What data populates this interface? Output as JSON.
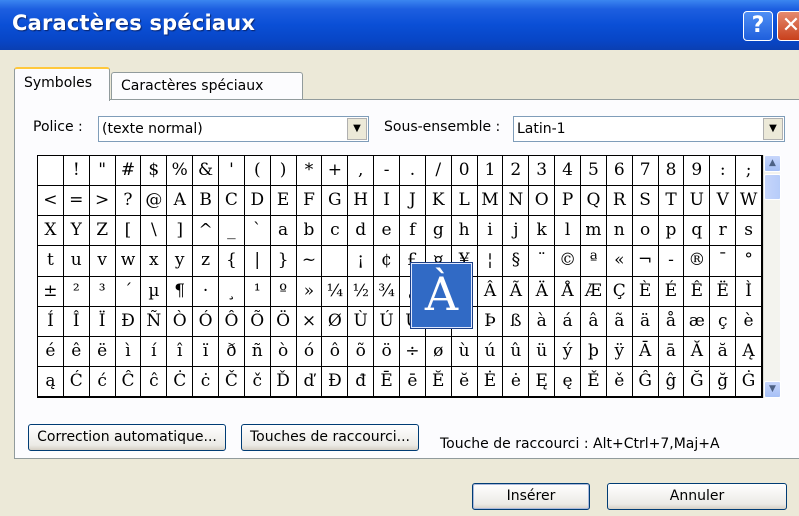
{
  "window": {
    "title": "Caractères spéciaux",
    "help_glyph": "?",
    "close_glyph": "✕"
  },
  "tabs": [
    {
      "label": "Symboles",
      "active": true
    },
    {
      "label": "Caractères spéciaux",
      "active": false
    }
  ],
  "font": {
    "label": "Police :",
    "value": "(texte normal)"
  },
  "subset": {
    "label": "Sous-ensemble :",
    "value": "Latin-1"
  },
  "grid": {
    "columns": 31,
    "rows": [
      [
        " ",
        "!",
        "\"",
        "#",
        "$",
        "%",
        "&",
        "'",
        "(",
        ")",
        "*",
        "+",
        ",",
        "-",
        ".",
        "/",
        "0",
        "1",
        "2",
        "3",
        "4",
        "5",
        "6",
        "7",
        "8",
        "9",
        ":",
        ";"
      ],
      [
        "<",
        "=",
        ">",
        "?",
        "@",
        "A",
        "B",
        "C",
        "D",
        "E",
        "F",
        "G",
        "H",
        "I",
        "J",
        "K",
        "L",
        "M",
        "N",
        "O",
        "P",
        "Q",
        "R",
        "S",
        "T",
        "U",
        "V",
        "W"
      ],
      [
        "X",
        "Y",
        "Z",
        "[",
        "\\",
        "]",
        "^",
        "_",
        "`",
        "a",
        "b",
        "c",
        "d",
        "e",
        "f",
        "g",
        "h",
        "i",
        "j",
        "k",
        "l",
        "m",
        "n",
        "o",
        "p",
        "q",
        "r",
        "s"
      ],
      [
        "t",
        "u",
        "v",
        "w",
        "x",
        "y",
        "z",
        "{",
        "|",
        "}",
        "~",
        " ",
        "¡",
        "¢",
        "£",
        "¤",
        "¥",
        "¦",
        "§",
        "¨",
        "©",
        "ª",
        "«",
        "¬",
        "-",
        "®",
        "¯",
        "°"
      ],
      [
        "±",
        "²",
        "³",
        "´",
        "µ",
        "¶",
        "·",
        "¸",
        "¹",
        "º",
        "»",
        "¼",
        "½",
        "¾",
        "¿",
        "À",
        "Á",
        "Â",
        "Ã",
        "Ä",
        "Å",
        "Æ",
        "Ç",
        "È",
        "É",
        "Ê",
        "Ë",
        "Ì"
      ],
      [
        "Í",
        "Î",
        "Ï",
        "Ð",
        "Ñ",
        "Ò",
        "Ó",
        "Ô",
        "Õ",
        "Ö",
        "×",
        "Ø",
        "Ù",
        "Ú",
        "Û",
        "Ü",
        "Ý",
        "Þ",
        "ß",
        "à",
        "á",
        "â",
        "ã",
        "ä",
        "å",
        "æ",
        "ç",
        "è"
      ],
      [
        "é",
        "ê",
        "ë",
        "ì",
        "í",
        "î",
        "ï",
        "ð",
        "ñ",
        "ò",
        "ó",
        "ô",
        "õ",
        "ö",
        "÷",
        "ø",
        "ù",
        "ú",
        "û",
        "ü",
        "ý",
        "þ",
        "ÿ",
        "Ā",
        "ā",
        "Ă",
        "ă",
        "Ą"
      ],
      [
        "ą",
        "Ć",
        "ć",
        "Ĉ",
        "ĉ",
        "Ċ",
        "ċ",
        "Č",
        "č",
        "Ď",
        "ď",
        "Đ",
        "đ",
        "Ē",
        "ē",
        "Ĕ",
        "ĕ",
        "Ė",
        "ė",
        "Ę",
        "ę",
        "Ě",
        "ě",
        "Ĝ",
        "ĝ",
        "Ğ",
        "ğ",
        "Ġ"
      ]
    ],
    "selected_preview": "À"
  },
  "buttons": {
    "autocorrect": "Correction automatique...",
    "shortcut_keys": "Touches de raccourci...",
    "insert": "Insérer",
    "cancel": "Annuler"
  },
  "shortcut": {
    "label": "Touche de raccourci :",
    "value": "Alt+Ctrl+7,Maj+A"
  },
  "colors": {
    "title_bar": "#0a4fd6",
    "selection": "#316ac5",
    "dialog_bg": "#ece9d8"
  }
}
